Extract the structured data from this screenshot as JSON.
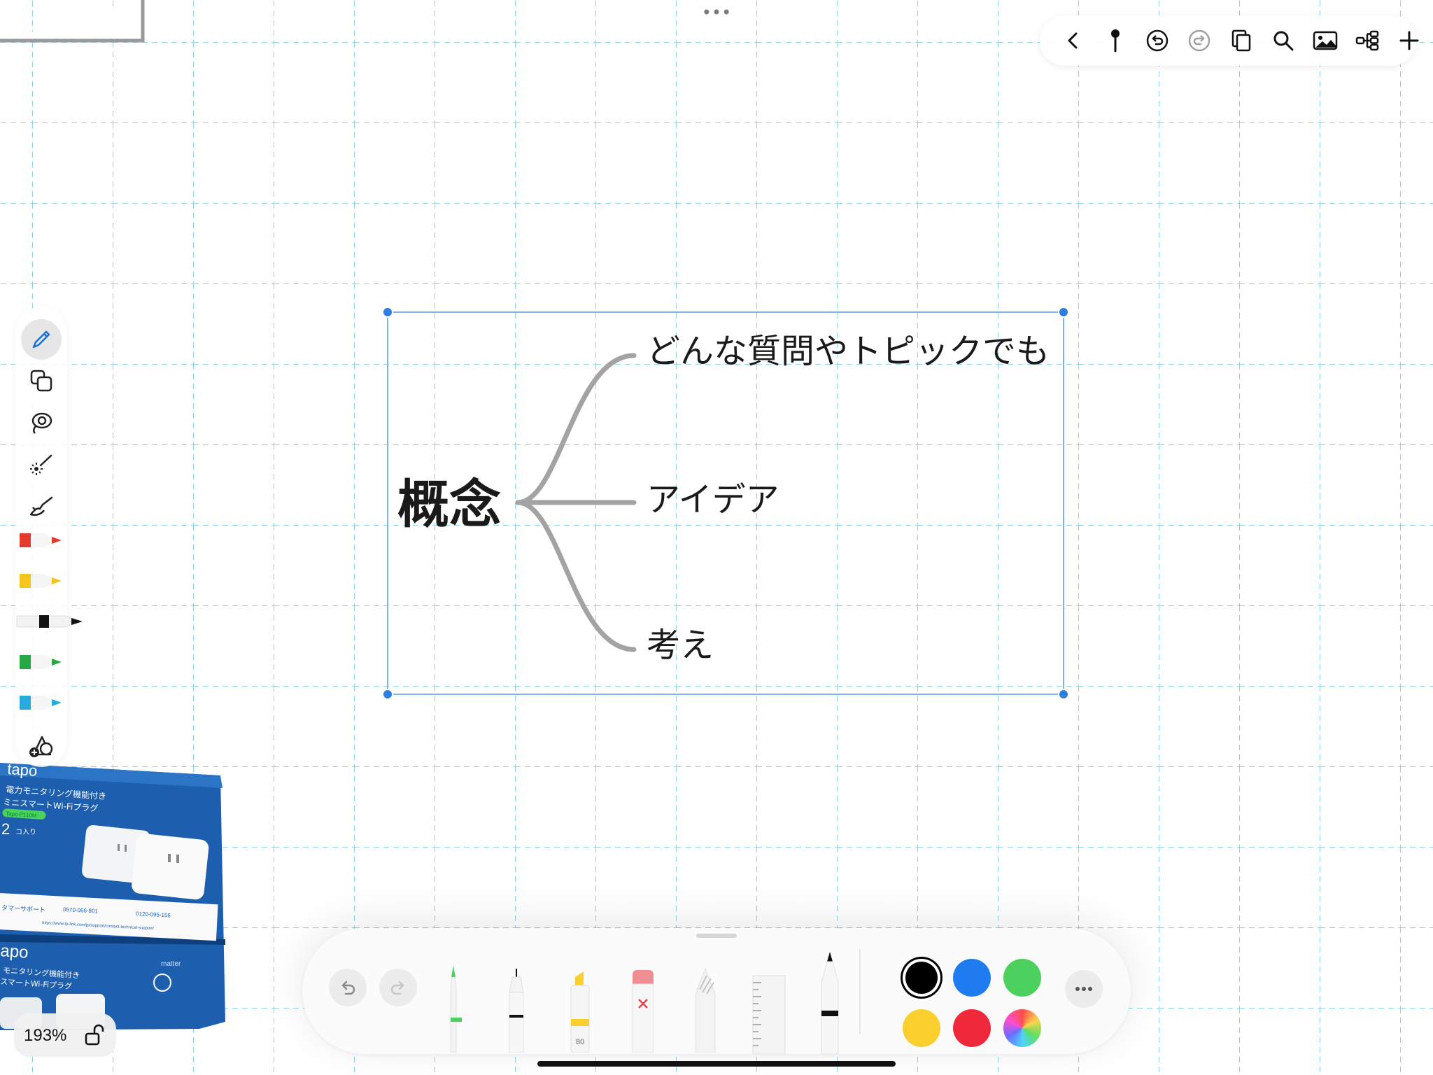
{
  "canvas": {
    "grid_color": "#8fd3e6",
    "page_handle": "•••"
  },
  "top_toolbar": {
    "icons": [
      "back-chevron-icon",
      "pin-icon",
      "undo-circle-icon",
      "redo-circle-icon",
      "pages-icon",
      "search-icon",
      "image-icon",
      "mindmap-icon",
      "add-icon"
    ]
  },
  "left_toolbar": {
    "tools": [
      "pencil-icon",
      "shapes-icon",
      "lasso-icon",
      "laser-pointer-icon",
      "hand-pen-icon"
    ],
    "pens": [
      {
        "color": "#e23b2e"
      },
      {
        "color": "#f5c51c"
      },
      {
        "color": "#111111"
      },
      {
        "color": "#27a844"
      },
      {
        "color": "#2aa8e0"
      }
    ],
    "add_tool_icon": "add-shape-icon"
  },
  "mindmap": {
    "root": "概念",
    "branches": [
      "どんな質問やトピックでも",
      "アイデア",
      "考え"
    ],
    "line_color": "#a3a3a3",
    "selection_color": "#4a90e2"
  },
  "photo": {
    "brand": "tapo",
    "product_line1": "電力モニタリング機能付き",
    "product_line2": "ミニスマートWi-Fiプラグ",
    "model": "Tapo P110M",
    "count": "2",
    "count_unit": "コ入り",
    "support": "タマーサポート",
    "phone1": "0570-066-801",
    "phone2": "0120-095-156",
    "url": "https://www.tp-link.com/jp/support/contact-technical-support/",
    "lower_brand": "apo",
    "lower_line1": "モニタリング機能付き",
    "lower_line2": "スマートWi-Fiプラグ",
    "matter": "matter",
    "box_color": "#1d5fae"
  },
  "zoom": {
    "label": "193%"
  },
  "pen_dock": {
    "marker_size": "80",
    "colors": [
      {
        "name": "black",
        "hex": "#000000",
        "selected": true
      },
      {
        "name": "blue",
        "hex": "#1e7bf0",
        "selected": false
      },
      {
        "name": "green",
        "hex": "#4cd15e",
        "selected": false
      },
      {
        "name": "yellow",
        "hex": "#fbcf2e",
        "selected": false
      },
      {
        "name": "red",
        "hex": "#f0283b",
        "selected": false
      },
      {
        "name": "multicolor",
        "hex": "rainbow",
        "selected": false
      }
    ],
    "more_icon": "ellipsis-icon"
  }
}
